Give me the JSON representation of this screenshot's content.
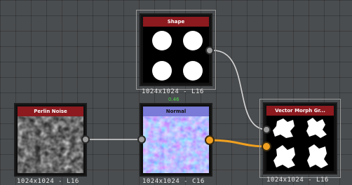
{
  "nodes": {
    "shape": {
      "title": "Shape",
      "resolution": "1024x1024 - L16"
    },
    "perlin_noise": {
      "title": "Perlin Noise",
      "resolution": "1024x1024 - L16"
    },
    "normal": {
      "title": "Normal",
      "resolution": "1024x1024 - C16",
      "pad_label": "0.46"
    },
    "vector_morph": {
      "title": "Vector Morph Gr...",
      "resolution": "1024x1024 - L16"
    }
  },
  "colors": {
    "background": "#4a4d4f",
    "node_header": "#8c1a1f",
    "link_gray": "#d8d8d8",
    "link_orange": "#f0a020"
  }
}
